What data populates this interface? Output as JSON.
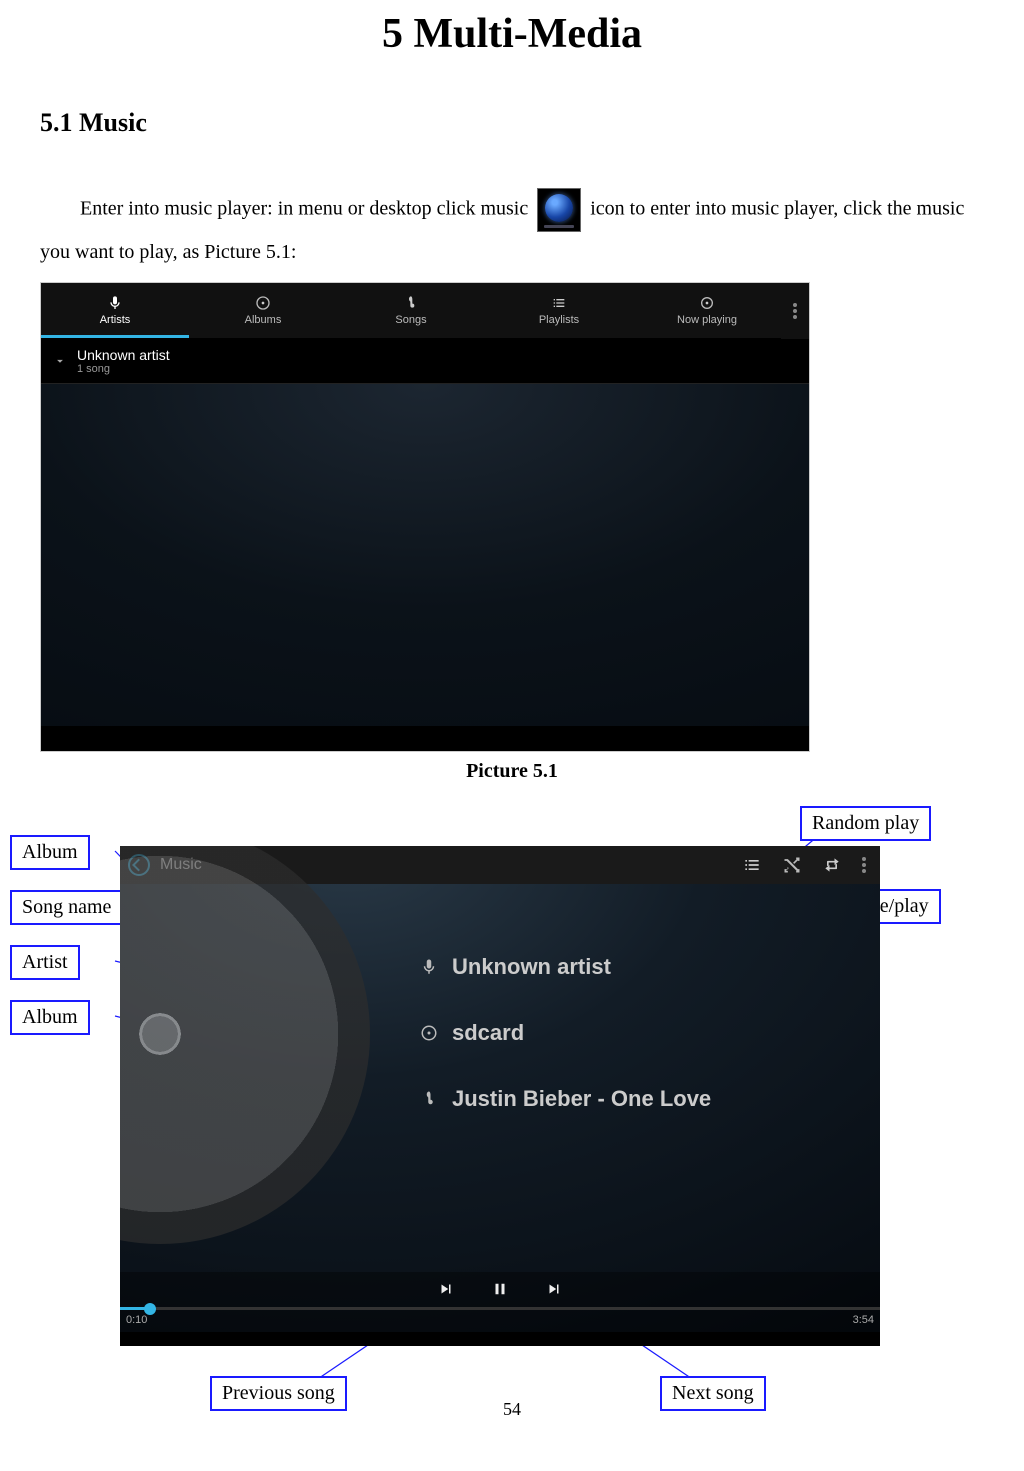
{
  "chapter_title": "5 Multi-Media",
  "section_title": "5.1 Music",
  "body_text_before_icon": "Enter into music player: in menu or desktop click music",
  "body_text_after_icon": "icon to enter into music player, click the music you want to play, as Picture 5.1:",
  "picture_caption_1": "Picture 5.1",
  "page_number": "54",
  "screenshot1": {
    "tabs": {
      "artists": "Artists",
      "albums": "Albums",
      "songs": "Songs",
      "playlists": "Playlists",
      "now_playing": "Now playing"
    },
    "artist_row": {
      "name": "Unknown artist",
      "subtitle": "1 song"
    }
  },
  "screenshot2": {
    "title": "Music",
    "artist": "Unknown artist",
    "album": "sdcard",
    "song": "Justin Bieber - One Love",
    "time_elapsed": "0:10",
    "time_total": "3:54"
  },
  "annotations": {
    "album_art": "Album",
    "song_name": "Song name",
    "artist": "Artist",
    "album": "Album",
    "random_play": "Random play",
    "pause_play": "Pause/play",
    "previous_song": "Previous song",
    "next_song": "Next song"
  }
}
